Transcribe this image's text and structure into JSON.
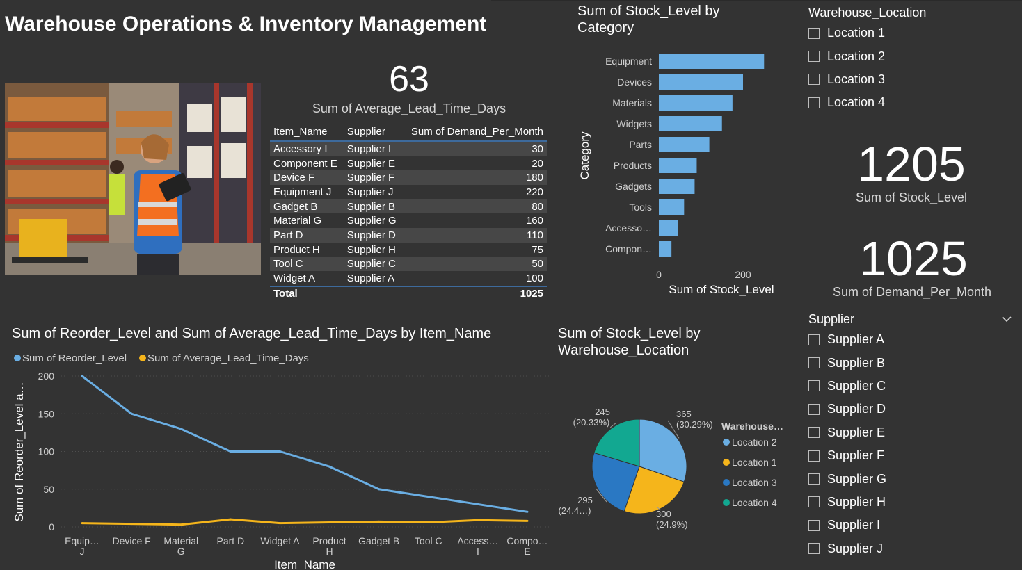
{
  "page": {
    "title": "Warehouse Operations & Inventory Management"
  },
  "kpis": {
    "lead_time": {
      "value": "63",
      "label": "Sum of Average_Lead_Time_Days"
    },
    "stock": {
      "value": "1205",
      "label": "Sum of Stock_Level"
    },
    "demand": {
      "value": "1025",
      "label": "Sum of Demand_Per_Month"
    }
  },
  "table": {
    "headers": [
      "Item_Name",
      "Supplier",
      "Sum of Demand_Per_Month"
    ],
    "rows": [
      [
        "Accessory I",
        "Supplier I",
        "30"
      ],
      [
        "Component E",
        "Supplier E",
        "20"
      ],
      [
        "Device F",
        "Supplier F",
        "180"
      ],
      [
        "Equipment J",
        "Supplier J",
        "220"
      ],
      [
        "Gadget B",
        "Supplier B",
        "80"
      ],
      [
        "Material G",
        "Supplier G",
        "160"
      ],
      [
        "Part D",
        "Supplier D",
        "110"
      ],
      [
        "Product H",
        "Supplier H",
        "75"
      ],
      [
        "Tool C",
        "Supplier C",
        "50"
      ],
      [
        "Widget A",
        "Supplier A",
        "100"
      ]
    ],
    "total": {
      "label": "Total",
      "value": "1025"
    }
  },
  "chart_data": [
    {
      "type": "bar",
      "orientation": "horizontal",
      "title": "Sum of Stock_Level by Category",
      "title_lines": [
        "Sum of Stock_Level by",
        "Category"
      ],
      "ylabel": "Category",
      "xlabel": "Sum of Stock_Level",
      "categories": [
        "Equipment",
        "Devices",
        "Materials",
        "Widgets",
        "Parts",
        "Products",
        "Gadgets",
        "Tools",
        "Accesso…",
        "Compon…"
      ],
      "values": [
        250,
        200,
        175,
        150,
        120,
        90,
        85,
        60,
        45,
        30
      ],
      "xticks": [
        0,
        200
      ],
      "color": "#6aaee3"
    },
    {
      "type": "line",
      "title": "Sum of Reorder_Level and Sum of Average_Lead_Time_Days by Item_Name",
      "xlabel": "Item_Name",
      "ylabel": "Sum of Reorder_Level a…",
      "categories": [
        "Equip… J",
        "Device F",
        "Material G",
        "Part D",
        "Widget A",
        "Product H",
        "Gadget B",
        "Tool C",
        "Access… I",
        "Compo… E"
      ],
      "category_lines": [
        [
          "Equip…",
          "J"
        ],
        [
          "Device F"
        ],
        [
          "Material",
          "G"
        ],
        [
          "Part D"
        ],
        [
          "Widget A"
        ],
        [
          "Product",
          "H"
        ],
        [
          "Gadget B"
        ],
        [
          "Tool C"
        ],
        [
          "Access…",
          "I"
        ],
        [
          "Compo…",
          "E"
        ]
      ],
      "ylim": [
        0,
        200
      ],
      "yticks": [
        0,
        50,
        100,
        150,
        200
      ],
      "grid": true,
      "legend": "top-left",
      "series": [
        {
          "name": "Sum of Reorder_Level",
          "color": "#6aaee3",
          "values": [
            200,
            150,
            130,
            100,
            100,
            80,
            50,
            40,
            30,
            20
          ]
        },
        {
          "name": "Sum of Average_Lead_Time_Days",
          "color": "#f5b51b",
          "values": [
            5,
            4,
            3,
            10,
            5,
            6,
            7,
            6,
            9,
            8
          ]
        }
      ]
    },
    {
      "type": "pie",
      "title": "Sum of Stock_Level by Warehouse_Location",
      "title_lines": [
        "Sum of Stock_Level by",
        "Warehouse_Location"
      ],
      "legend_title": "Warehouse…",
      "legend": "right",
      "slices": [
        {
          "name": "Location 2",
          "value": 365,
          "color": "#6aaee3",
          "label": "365",
          "pct": "(30.29%)"
        },
        {
          "name": "Location 1",
          "value": 300,
          "color": "#f5b51b",
          "label": "300",
          "pct": "(24.9%)"
        },
        {
          "name": "Location 3",
          "value": 295,
          "color": "#2a78c3",
          "label": "295",
          "pct": "(24.4…)"
        },
        {
          "name": "Location 4",
          "value": 245,
          "color": "#12a891",
          "label": "245",
          "pct": "(20.33%)"
        }
      ]
    }
  ],
  "slicers": {
    "warehouse": {
      "title": "Warehouse_Location",
      "items": [
        "Location 1",
        "Location 2",
        "Location 3",
        "Location 4"
      ]
    },
    "supplier": {
      "title": "Supplier",
      "items": [
        "Supplier A",
        "Supplier B",
        "Supplier C",
        "Supplier D",
        "Supplier E",
        "Supplier F",
        "Supplier G",
        "Supplier H",
        "Supplier I",
        "Supplier J"
      ]
    }
  },
  "icons": {
    "supplier_dropdown": "chevron-down-icon"
  }
}
